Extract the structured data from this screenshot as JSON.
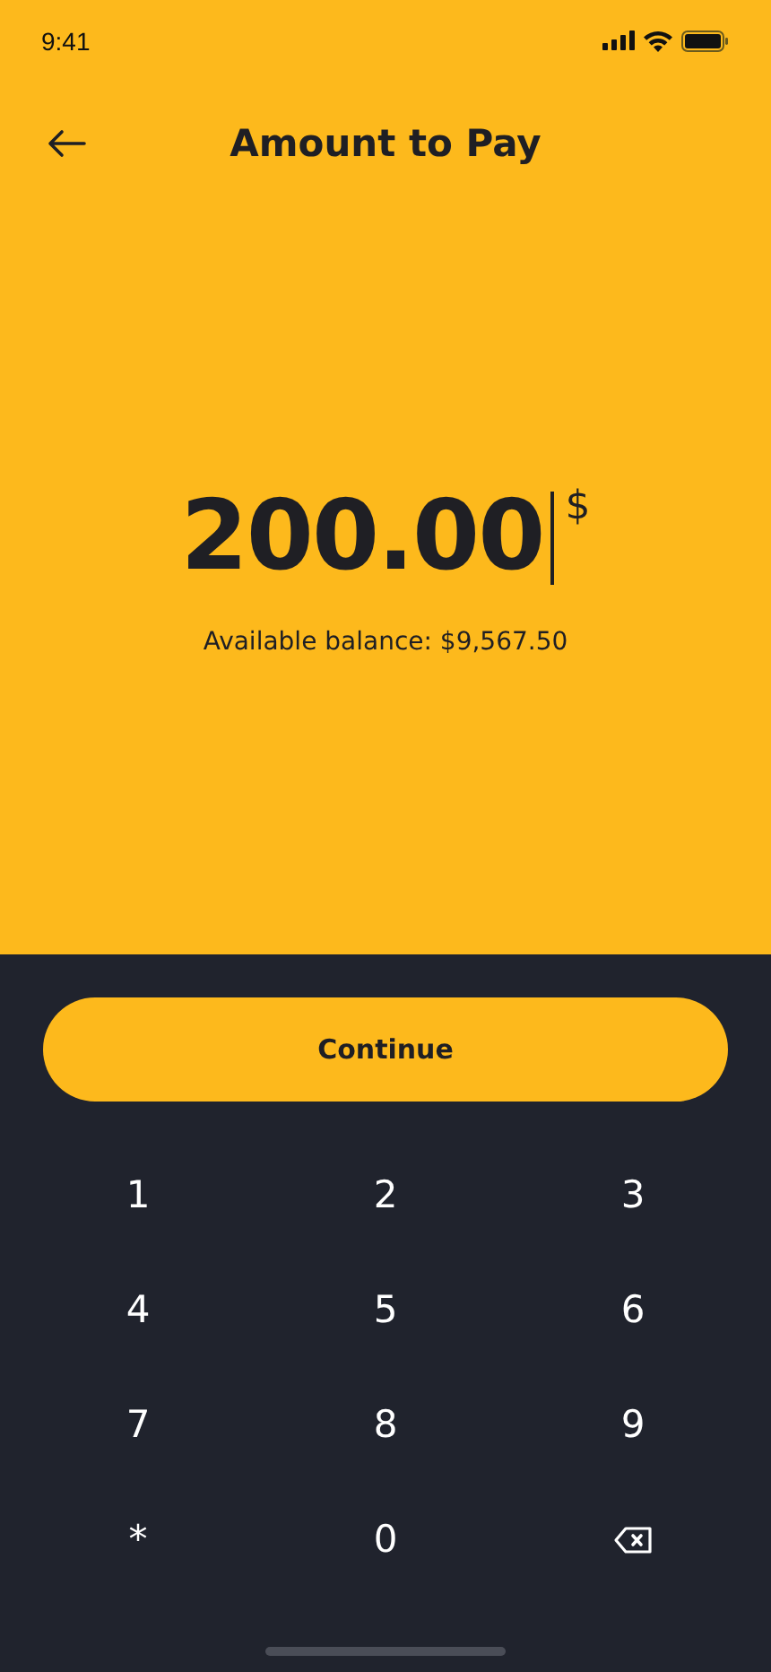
{
  "status_bar": {
    "time": "9:41"
  },
  "header": {
    "title": "Amount to Pay"
  },
  "amount": {
    "value": "200.00",
    "currency": "$"
  },
  "balance": "Available balance: $9,567.50",
  "continue_button": "Continue",
  "keypad": [
    {
      "kind": "digit",
      "label": "1"
    },
    {
      "kind": "digit",
      "label": "2"
    },
    {
      "kind": "digit",
      "label": "3"
    },
    {
      "kind": "digit",
      "label": "4"
    },
    {
      "kind": "digit",
      "label": "5"
    },
    {
      "kind": "digit",
      "label": "6"
    },
    {
      "kind": "digit",
      "label": "7"
    },
    {
      "kind": "digit",
      "label": "8"
    },
    {
      "kind": "digit",
      "label": "9"
    },
    {
      "kind": "digit",
      "label": "*"
    },
    {
      "kind": "digit",
      "label": "0"
    },
    {
      "kind": "backspace"
    }
  ]
}
